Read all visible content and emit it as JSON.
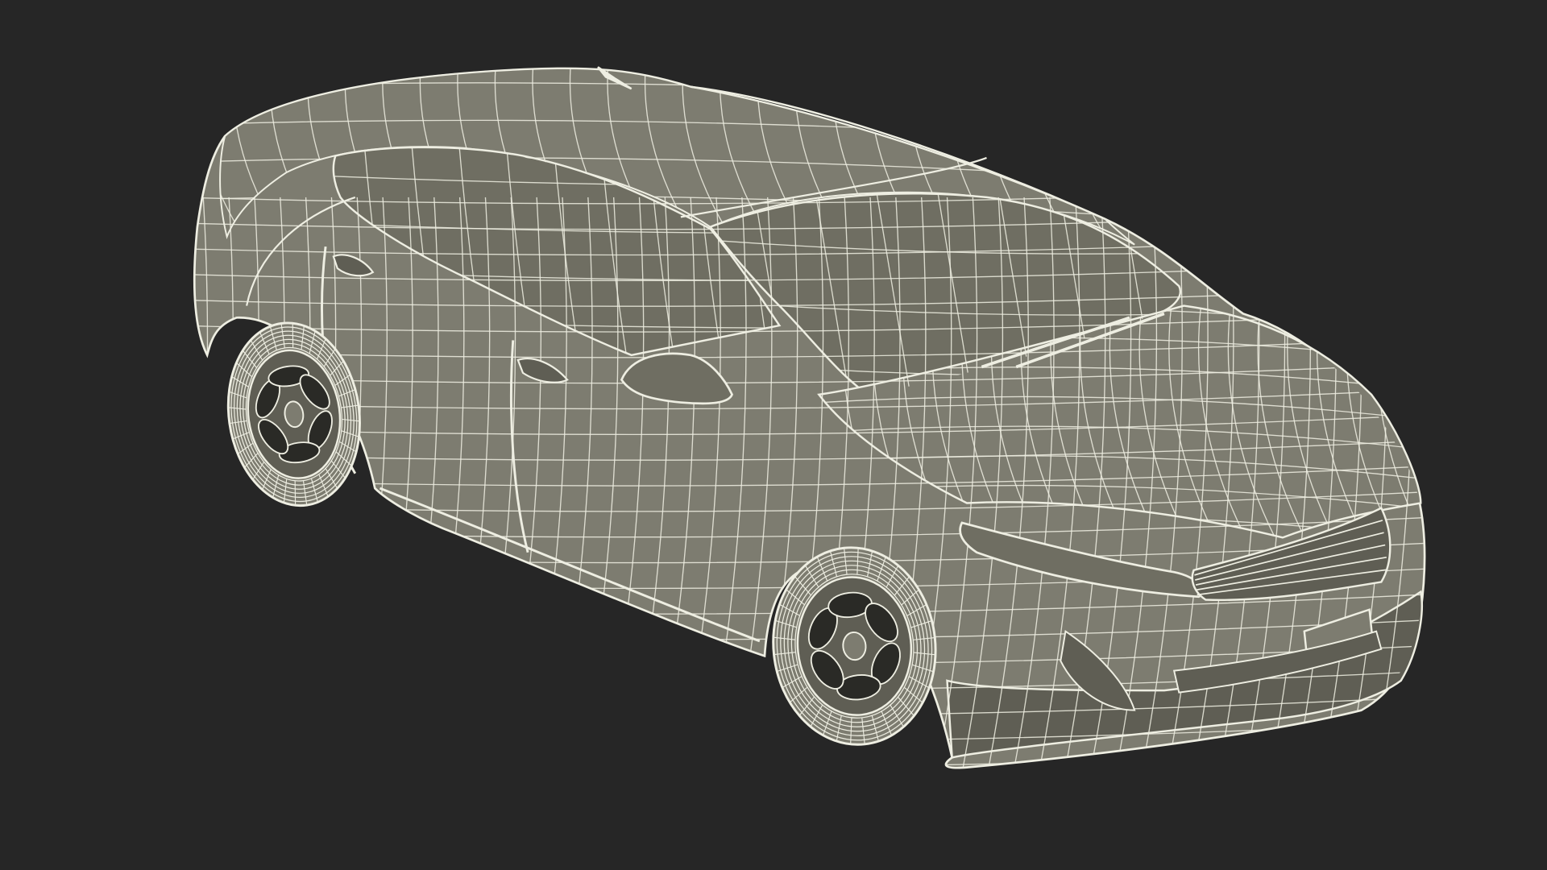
{
  "scene": {
    "subject": "car-wireframe-render",
    "colors": {
      "background": "#262626",
      "surface": "#7d7c70",
      "surface_shade": "#6f6e62",
      "surface_dark": "#5f5e54",
      "wire": "#eeeee2",
      "wheel_hole": "#2a2a26"
    }
  }
}
